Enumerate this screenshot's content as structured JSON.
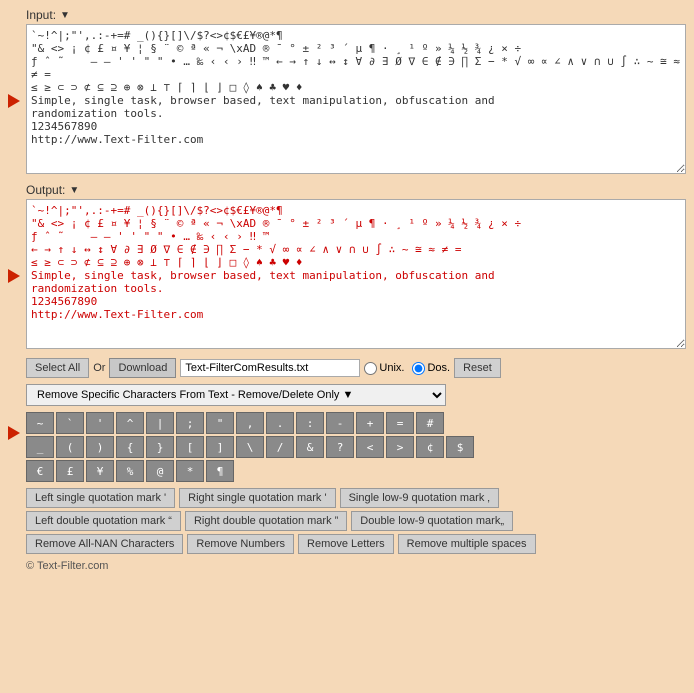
{
  "input": {
    "label": "Input:",
    "arrow": "▼",
    "content": "`~!^|;\"',.:-+=# _(){}[]\\/$?<>¢$€£¥®@*¶\n\"& <> ¡ ¢ £ ¤ ¥ ¦ § ¨ © ª « ¬ \\xAD ® ¯ ° ± ² ³ ´ µ ¶ · ¸ ¹ º » ¼ ½ ¾ ¿ × ÷\nƒ ˆ ˜    — – ' ' \" \" • … ‰ ‹ ‹ › ‼ ™ ← → ↑ ↓ ↔ ↕ ∀ ∂ ∃ Ø ∇ ∈ ∉ ∋ ∏ Σ − * √ ∞ ∝ ∠ ∧ ∨ ∩ ∪ ∫ ∴ ~ ≅ ≈ ≠ =\n≤ ≥ ⊂ ⊃ ⊄ ⊆ ⊇ ⊕ ⊗ ⊥ ⊤ ⌈ ⌉ ⌊ ⌋ □ ◊ ♠ ♣ ♥ ♦\nSimple, single task, browser based, text manipulation, obfuscation and\nrandomization tools.\n1234567890\nhttp://www.Text-Filter.com"
  },
  "output": {
    "label": "Output:",
    "arrow": "▼",
    "content": "`~!^|;\"',.:-+=# _(){}[]\\/$?<>¢$€£¥®@*¶\n\"& <> ¡ ¢ £ ¤ ¥ ¦ § ¨ © ª « ¬ \\xAD ® ¯ ° ± ² ³ ´ µ ¶ · ¸ ¹ º » ¼ ½ ¾ ¿ × ÷\nƒ ˆ ˜    — – ' ' \" \" • … ‰ ‹ ‹ › ‼ ™\n← → ↑ ↓ ↔ ↕ ∀ ∂ ∃ Ø ∇ ∈ ∉ ∋ ∏ Σ − * √ ∞ ∝ ∠ ∧ ∨ ∩ ∪ ∫ ∴ ~ ≅ ≈ ≠ =\n≤ ≥ ⊂ ⊃ ⊄ ⊆ ⊇ ⊕ ⊗ ⊥ ⊤ ⌈ ⌉ ⌊ ⌋ □ ◊ ♠ ♣ ♥ ♦\nSimple, single task, browser based, text manipulation, obfuscation and\nrandomization tools.\n1234567890\nhttp://www.Text-Filter.com"
  },
  "toolbar": {
    "select_all": "Select All",
    "or": "Or",
    "download": "Download",
    "filename": "Text-FilterComResults.txt",
    "unix_label": "Unix.",
    "dos_label": "Dos.",
    "reset": "Reset"
  },
  "dropdown": {
    "options": [
      "Remove Specific Characters From Text - Remove/Delete Only ▼"
    ],
    "selected": "Remove Specific Characters From Text - Remove/Delete Only ▼"
  },
  "char_rows": [
    [
      "~",
      "`",
      "'",
      "^",
      "|",
      ";",
      "\"",
      ",",
      ".",
      ":",
      "-",
      "+",
      "=",
      "#"
    ],
    [
      "-",
      "(",
      ")",
      "{",
      "}",
      "[",
      "]",
      "\\",
      "/",
      "&",
      "?",
      "<",
      ">",
      "¢",
      "$"
    ],
    [
      "€",
      "£",
      "¥",
      "%",
      "@",
      "*",
      "¶"
    ]
  ],
  "special_buttons": {
    "row1": [
      "Left single quotation mark '",
      "Right single quotation mark '",
      "Single low-9 quotation mark ‚"
    ],
    "row2": [
      "Left double quotation mark “",
      "Right double quotation mark ”",
      "Double low-9 quotation mark„"
    ],
    "row3": [
      "Remove All-NAN Characters",
      "Remove Numbers",
      "Remove Letters",
      "Remove multiple spaces"
    ]
  },
  "footer": {
    "copyright": "© Text-Filter.com"
  }
}
